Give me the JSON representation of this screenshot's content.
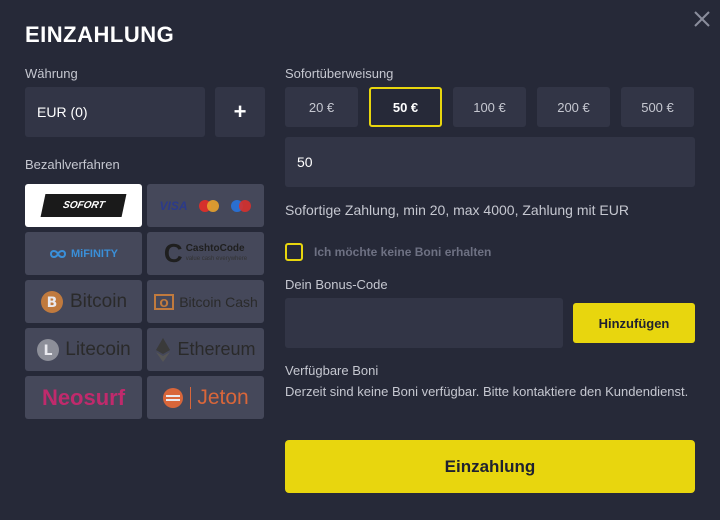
{
  "title": "EINZAHLUNG",
  "currency": {
    "label": "Währung",
    "value": "EUR (0)",
    "add_label": "+"
  },
  "payment_methods": {
    "label": "Bezahlverfahren",
    "items": [
      {
        "name": "SOFORT",
        "selected": true
      },
      {
        "name": "VISA",
        "selected": false
      },
      {
        "name": "MiFINITY",
        "selected": false
      },
      {
        "name": "CashtoCode",
        "subtitle": "value cash everywhere",
        "selected": false
      },
      {
        "name": "Bitcoin",
        "selected": false
      },
      {
        "name": "Bitcoin Cash",
        "selected": false
      },
      {
        "name": "Litecoin",
        "selected": false
      },
      {
        "name": "Ethereum",
        "selected": false
      },
      {
        "name": "Neosurf",
        "selected": false
      },
      {
        "name": "Jeton",
        "selected": false
      }
    ]
  },
  "transfer": {
    "label": "Sofortüberweisung",
    "amounts": [
      "20 €",
      "50 €",
      "100 €",
      "200 €",
      "500 €"
    ],
    "selected_amount": "50 €",
    "amount_value": "50",
    "info": "Sofortige Zahlung, min 20, max 4000, Zahlung mit EUR"
  },
  "no_bonus_label": "Ich möchte keine Boni erhalten",
  "bonus_code": {
    "label": "Dein Bonus-Code",
    "value": "",
    "add_label": "Hinzufügen"
  },
  "available_bonuses": {
    "label": "Verfügbare Boni",
    "text": "Derzeit sind keine Boni verfügbar. Bitte kontaktiere den Kundendienst."
  },
  "submit_label": "Einzahlung",
  "colors": {
    "background": "#262938",
    "panel": "#323546",
    "accent": "#e8d60e",
    "tile": "#45485a"
  }
}
